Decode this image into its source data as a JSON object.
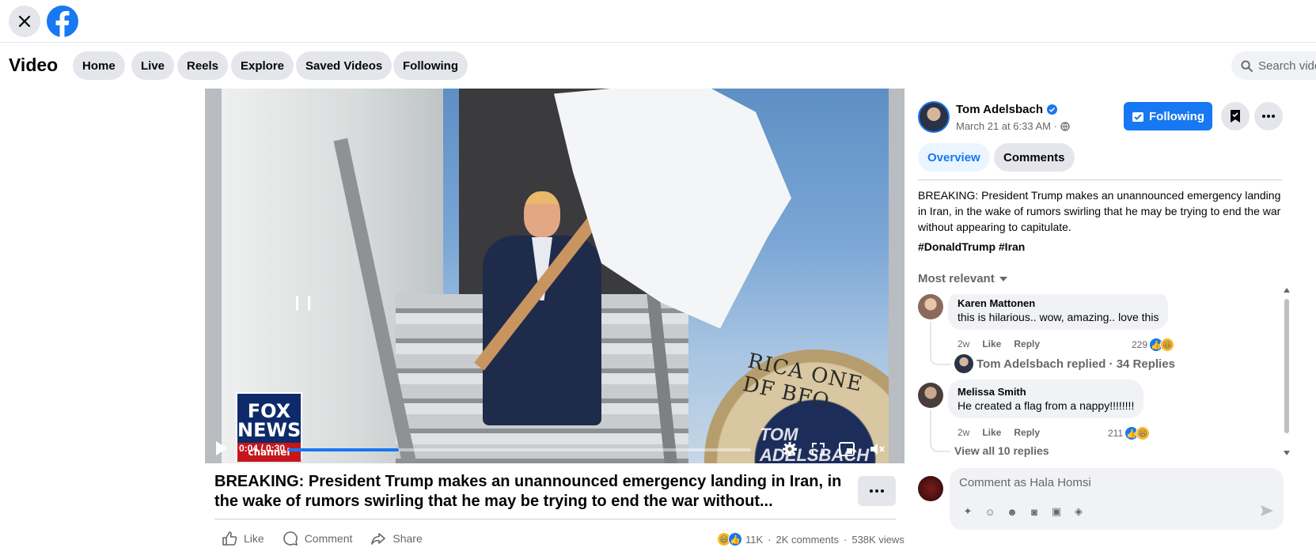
{
  "nav": {
    "title": "Video",
    "pills": [
      "Home",
      "Live",
      "Reels",
      "Explore",
      "Saved Videos",
      "Following"
    ],
    "search_placeholder": "Search vide"
  },
  "video": {
    "time": "0:04 / 0:30",
    "progress_fraction": 0.24,
    "watermark": "TOM ADELSBACH",
    "logo_text": [
      "FOX",
      "NEWS"
    ],
    "logo_sub": "channel",
    "seal_text": "RICA ONE  DF BFO",
    "title": "BREAKING: President Trump makes an unannounced emergency landing in Iran, in the wake of rumors swirling that he may be trying to end the war without...",
    "actions": {
      "like": "Like",
      "comment": "Comment",
      "share": "Share"
    },
    "stats": {
      "reactions": "11K",
      "comments": "2K comments",
      "views": "538K views"
    }
  },
  "post": {
    "author": "Tom Adelsbach",
    "date": "March 21 at 6:33 AM ·",
    "follow_label": "Following",
    "tabs": [
      "Overview",
      "Comments"
    ],
    "description": "BREAKING: President Trump makes an unannounced emergency landing in Iran, in the wake of rumors swirling that he may be trying to end the war without appearing to capitulate.",
    "hashtags": "#DonaldTrump #Iran",
    "sort_label": "Most relevant"
  },
  "comments": [
    {
      "name": "Karen Mattonen",
      "text": "this is hilarious.. wow, amazing.. love this",
      "time": "2w",
      "like": "Like",
      "reply": "Reply",
      "count": "229",
      "replied": "Tom Adelsbach replied · 34 Replies"
    },
    {
      "name": "Melissa Smith",
      "text": "He created a flag from a nappy!!!!!!!!",
      "time": "2w",
      "like": "Like",
      "reply": "Reply",
      "count": "211",
      "replied": "View all 10 replies"
    }
  ],
  "composer": {
    "placeholder": "Comment as Hala Homsi"
  },
  "colors": {
    "brand": "#1877f2",
    "pill_bg": "#e4e6eb",
    "muted": "#65676b"
  }
}
